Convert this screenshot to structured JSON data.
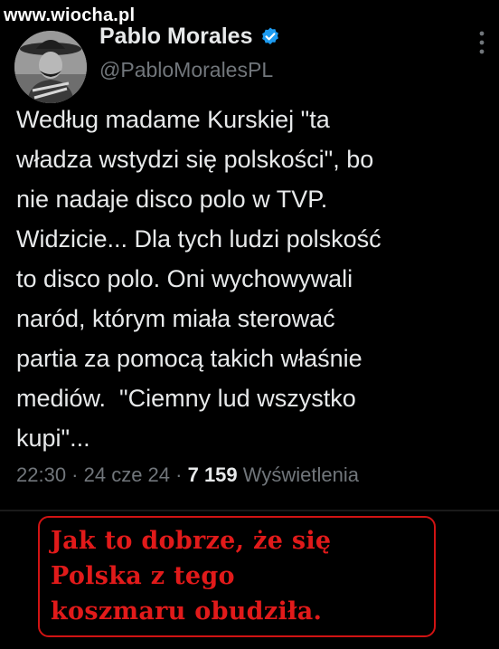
{
  "watermark": "www.wiocha.pl",
  "tweet": {
    "display_name": "Pablo Morales",
    "verified_icon": "verified-badge-icon",
    "handle": "@PabloMoralesPL",
    "more_icon": "more-vertical-icon",
    "text_lines": [
      "Według madame Kurskiej \"ta",
      "władza wstydzi się polskości\", bo",
      "nie nadaje disco polo w TVP.",
      "Widzicie... Dla tych ludzi polskość",
      "to disco polo. Oni wychowywali",
      "naród, którym miała sterować",
      "partia za pomocą takich właśnie",
      "mediów.  \"Ciemny lud wszystko",
      "kupi\"..."
    ],
    "meta": {
      "time": "22:30",
      "separator": " · ",
      "date": "24 cze 24",
      "views_count": "7 159",
      "views_label": "Wyświetlenia"
    }
  },
  "caption": {
    "lines": [
      "Jak to dobrze, że się",
      "Polska z tego",
      "koszmaru obudziła."
    ]
  },
  "colors": {
    "background": "#000000",
    "text": "#e7e9ea",
    "muted": "#71767b",
    "verified": "#1d9bf0",
    "caption_red": "#e11a1a"
  }
}
